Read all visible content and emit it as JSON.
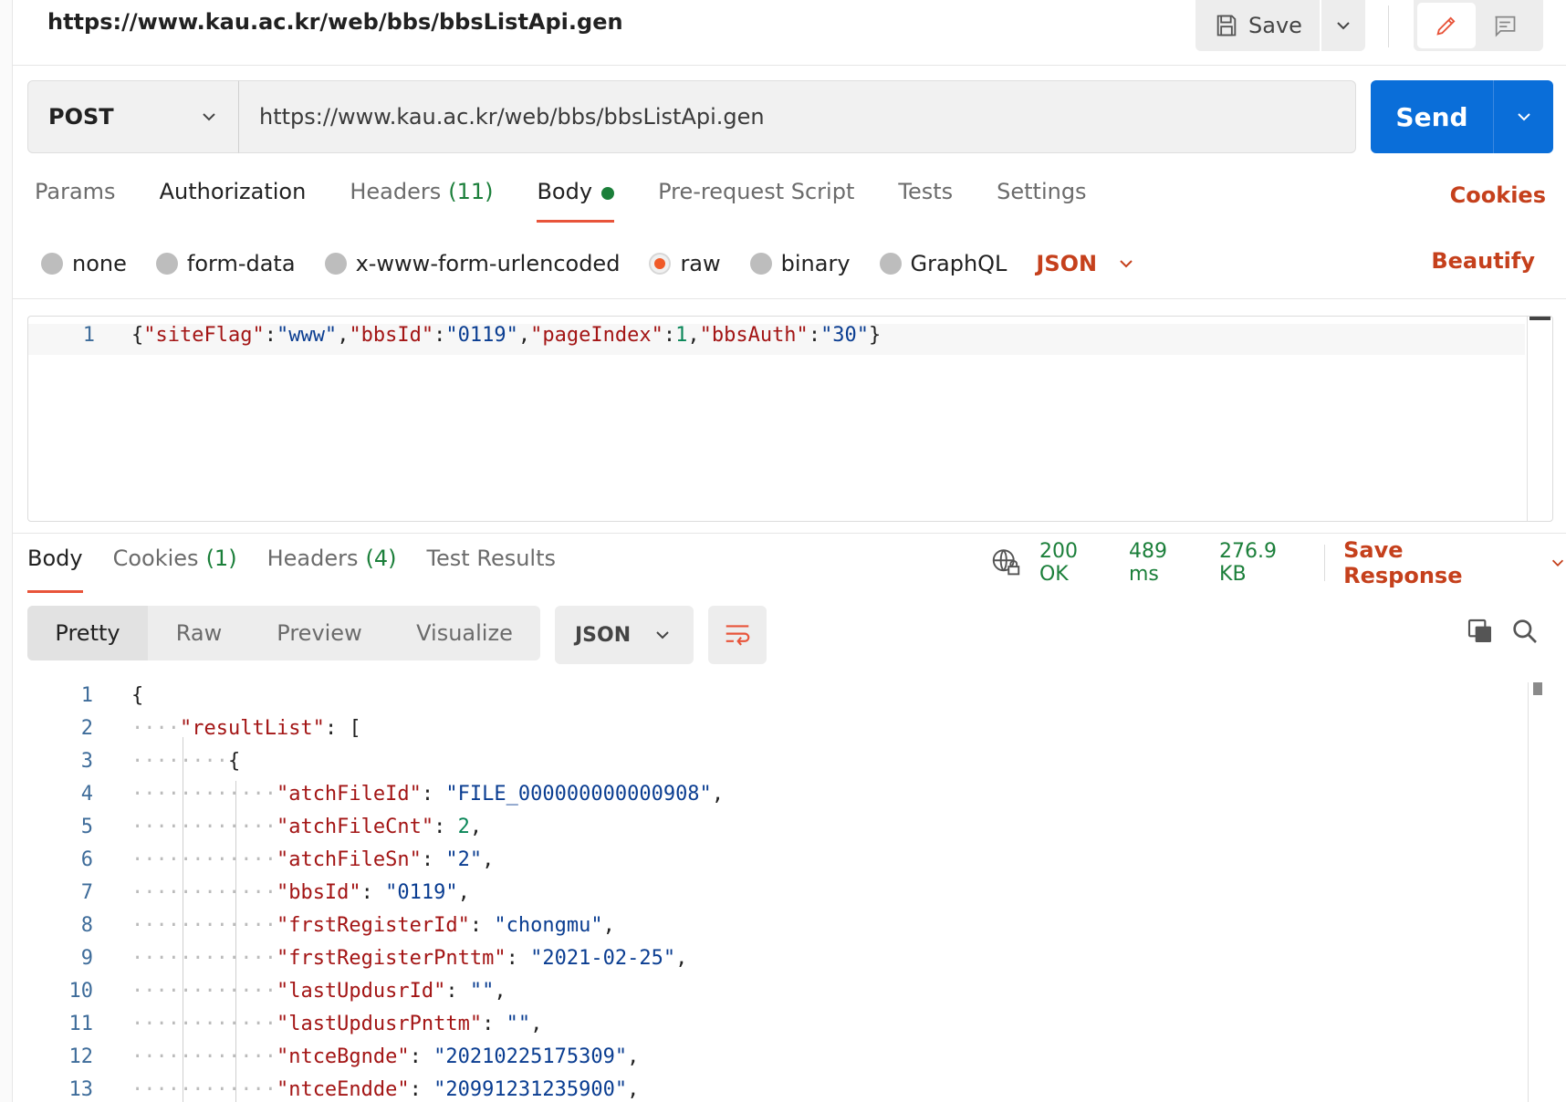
{
  "request": {
    "title": "https://www.kau.ac.kr/web/bbs/bbsListApi.gen",
    "save_label": "Save",
    "method": "POST",
    "url": "https://www.kau.ac.kr/web/bbs/bbsListApi.gen",
    "send_label": "Send",
    "tabs": [
      {
        "label": "Params"
      },
      {
        "label": "Authorization"
      },
      {
        "label": "Headers",
        "count": "(11)"
      },
      {
        "label": "Body"
      },
      {
        "label": "Pre-request Script"
      },
      {
        "label": "Tests"
      },
      {
        "label": "Settings"
      }
    ],
    "cookies_label": "Cookies",
    "body_modes": [
      "none",
      "form-data",
      "x-www-form-urlencoded",
      "raw",
      "binary",
      "GraphQL"
    ],
    "selected_body_mode": "raw",
    "language": "JSON",
    "beautify_label": "Beautify",
    "body_line_number": "1",
    "body_tokens": {
      "t1": "{",
      "t2": "\"siteFlag\"",
      "t3": ":",
      "t4": "\"www\"",
      "t5": ",",
      "t6": "\"bbsId\"",
      "t7": ":",
      "t8": "\"0119\"",
      "t9": ",",
      "t10": "\"pageIndex\"",
      "t11": ":",
      "t12": "1",
      "t13": ",",
      "t14": "\"bbsAuth\"",
      "t15": ":",
      "t16": "\"30\"",
      "t17": "}"
    }
  },
  "response": {
    "tabs": [
      {
        "label": "Body"
      },
      {
        "label": "Cookies",
        "count": "(1)"
      },
      {
        "label": "Headers",
        "count": "(4)"
      },
      {
        "label": "Test Results"
      }
    ],
    "status": "200 OK",
    "time": "489 ms",
    "size": "276.9 KB",
    "save_response_label": "Save Response",
    "views": [
      "Pretty",
      "Raw",
      "Preview",
      "Visualize"
    ],
    "format": "JSON",
    "lines": [
      {
        "n": "1",
        "key": "",
        "val": "{",
        "vtype": "p",
        "sep": "",
        "tail": ""
      },
      {
        "n": "2",
        "key": "\"resultList\"",
        "sep": ": ",
        "val": "[",
        "vtype": "p",
        "tail": ""
      },
      {
        "n": "3",
        "key": "",
        "sep": "",
        "val": "{",
        "vtype": "p",
        "tail": ""
      },
      {
        "n": "4",
        "key": "\"atchFileId\"",
        "sep": ": ",
        "val": "\"FILE_000000000000908\"",
        "vtype": "s",
        "tail": ","
      },
      {
        "n": "5",
        "key": "\"atchFileCnt\"",
        "sep": ": ",
        "val": "2",
        "vtype": "n",
        "tail": ","
      },
      {
        "n": "6",
        "key": "\"atchFileSn\"",
        "sep": ": ",
        "val": "\"2\"",
        "vtype": "s",
        "tail": ","
      },
      {
        "n": "7",
        "key": "\"bbsId\"",
        "sep": ": ",
        "val": "\"0119\"",
        "vtype": "s",
        "tail": ","
      },
      {
        "n": "8",
        "key": "\"frstRegisterId\"",
        "sep": ": ",
        "val": "\"chongmu\"",
        "vtype": "s",
        "tail": ","
      },
      {
        "n": "9",
        "key": "\"frstRegisterPnttm\"",
        "sep": ": ",
        "val": "\"2021-02-25\"",
        "vtype": "s",
        "tail": ","
      },
      {
        "n": "10",
        "key": "\"lastUpdusrId\"",
        "sep": ": ",
        "val": "\"\"",
        "vtype": "s",
        "tail": ","
      },
      {
        "n": "11",
        "key": "\"lastUpdusrPnttm\"",
        "sep": ": ",
        "val": "\"\"",
        "vtype": "s",
        "tail": ","
      },
      {
        "n": "12",
        "key": "\"ntceBgnde\"",
        "sep": ": ",
        "val": "\"20210225175309\"",
        "vtype": "s",
        "tail": ","
      },
      {
        "n": "13",
        "key": "\"ntceEndde\"",
        "sep": ": ",
        "val": "\"20991231235900\"",
        "vtype": "s",
        "tail": ","
      }
    ]
  }
}
